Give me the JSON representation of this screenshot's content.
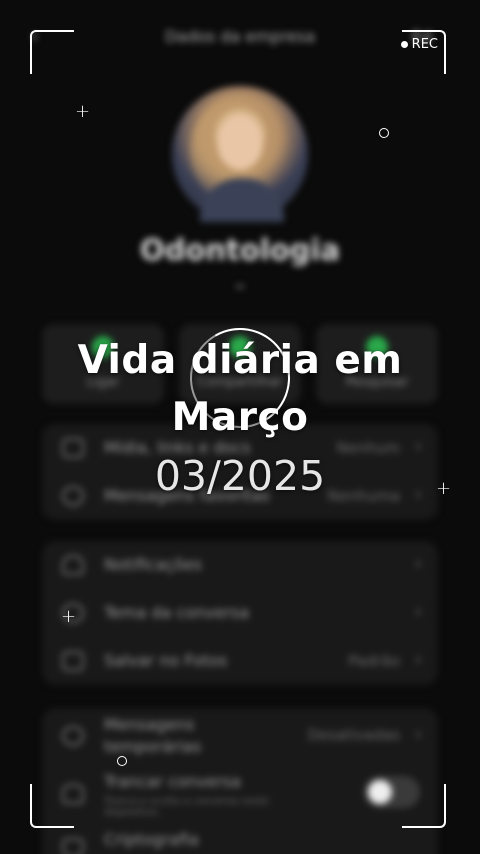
{
  "header": {
    "title": "Dados da empresa",
    "back_icon": "‹",
    "edit_label": "Ed"
  },
  "profile": {
    "name": "Odontologia",
    "photo": "person-photo"
  },
  "actions": [
    {
      "label": "Ligar",
      "icon": "phone-icon",
      "color": "#2aa84a"
    },
    {
      "label": "Compartilhar",
      "icon": "share-icon",
      "color": "#2aa84a"
    },
    {
      "label": "Pesquisar",
      "icon": "search-icon",
      "color": "#2aa84a"
    }
  ],
  "media_card": [
    {
      "label": "Mídia, links e docs",
      "value": "Nenhum",
      "icon": "image-icon"
    },
    {
      "label": "Mensagens favoritas",
      "value": "Nenhuma",
      "icon": "star-icon"
    }
  ],
  "settings_card": [
    {
      "label": "Notificações",
      "value": "",
      "icon": "bell-icon"
    },
    {
      "label": "Tema da conversa",
      "value": "",
      "icon": "palette-icon"
    },
    {
      "label": "Salvar no Fotos",
      "value": "Padrão",
      "icon": "download-icon"
    }
  ],
  "privacy_card": [
    {
      "label": "Mensagens temporárias",
      "value": "Desativadas",
      "icon": "timer-icon"
    },
    {
      "label": "Trancar conversa",
      "sub": "Tranca e oculta a conversa neste dispositivo.",
      "toggle": false,
      "icon": "lock-icon"
    },
    {
      "label": "Criptografia",
      "icon": "shield-icon"
    }
  ],
  "overlay": {
    "rec_label": "REC",
    "title": "Vida diária em Março",
    "title_line1": "Vida diária em",
    "title_line2": "Março",
    "date": "03/2025"
  }
}
